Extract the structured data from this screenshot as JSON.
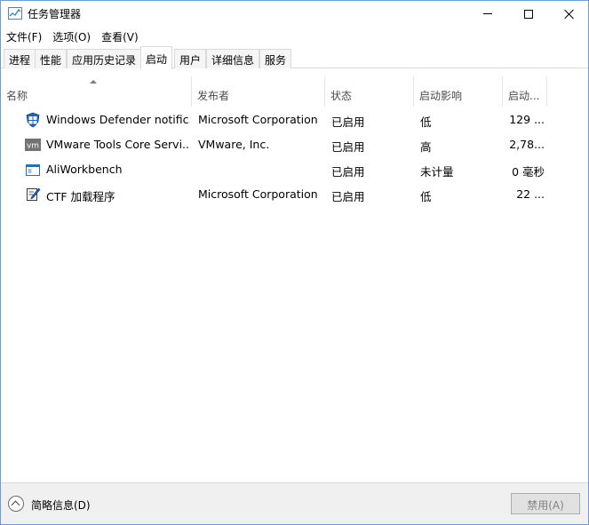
{
  "window": {
    "title": "任务管理器",
    "icon": "task-manager-icon"
  },
  "menu": [
    "文件(F)",
    "选项(O)",
    "查看(V)"
  ],
  "tabs": [
    {
      "label": "进程",
      "active": false
    },
    {
      "label": "性能",
      "active": false
    },
    {
      "label": "应用历史记录",
      "active": false
    },
    {
      "label": "启动",
      "active": true
    },
    {
      "label": "用户",
      "active": false
    },
    {
      "label": "详细信息",
      "active": false
    },
    {
      "label": "服务",
      "active": false
    }
  ],
  "columns": {
    "name": "名称",
    "publisher": "发布者",
    "status": "状态",
    "impact": "启动影响",
    "time": "启动..."
  },
  "rows": [
    {
      "icon": "windows-defender-icon",
      "name": "Windows Defender notific...",
      "publisher": "Microsoft Corporation",
      "status": "已启用",
      "impact": "低",
      "time": "129 ..."
    },
    {
      "icon": "vmware-icon",
      "name": "VMware Tools Core Servi...",
      "publisher": "VMware, Inc.",
      "status": "已启用",
      "impact": "高",
      "time": "2,78..."
    },
    {
      "icon": "application-window-icon",
      "name": "AliWorkbench",
      "publisher": "",
      "status": "已启用",
      "impact": "未计量",
      "time": "0 毫秒"
    },
    {
      "icon": "ctf-pen-icon",
      "name": "CTF 加载程序",
      "publisher": "Microsoft Corporation",
      "status": "已启用",
      "impact": "低",
      "time": "22 ..."
    }
  ],
  "footer": {
    "fewer_details": "简略信息(D)",
    "disable_button": "禁用(A)"
  }
}
